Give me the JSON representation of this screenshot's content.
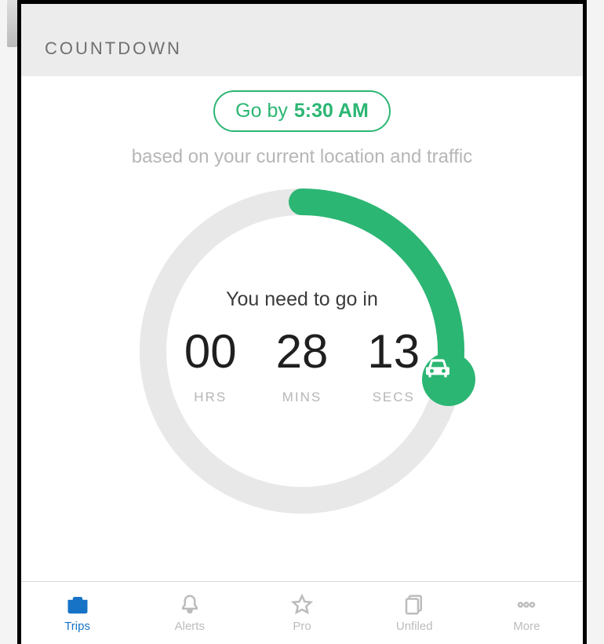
{
  "section_title": "COUNTDOWN",
  "go_by": {
    "prefix": "Go by",
    "time": "5:30 AM"
  },
  "based_on": "based on your current location and traffic",
  "need_text": "You need to go in",
  "countdown": {
    "hours": {
      "value": "00",
      "label": "HRS"
    },
    "mins": {
      "value": "28",
      "label": "MINS"
    },
    "secs": {
      "value": "13",
      "label": "SECS"
    }
  },
  "progress_fraction": 0.28,
  "tabs": {
    "trips": "Trips",
    "alerts": "Alerts",
    "pro": "Pro",
    "unfiled": "Unfiled",
    "more": "More"
  },
  "colors": {
    "accent": "#2cb673",
    "track": "#e8e8e8",
    "active_tab": "#1773c6"
  }
}
